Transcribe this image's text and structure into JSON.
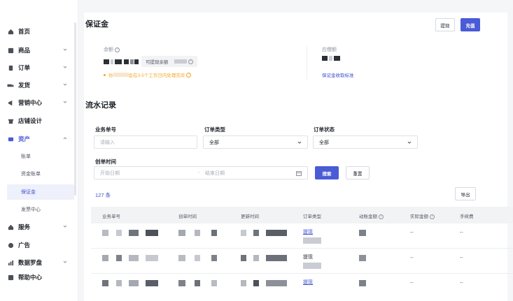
{
  "sidebar": {
    "items": [
      {
        "label": "首页",
        "icon": "home-icon"
      },
      {
        "label": "商品",
        "icon": "goods-icon"
      },
      {
        "label": "订单",
        "icon": "order-icon"
      },
      {
        "label": "发货",
        "icon": "truck-icon"
      },
      {
        "label": "营销中心",
        "icon": "megaphone-icon"
      },
      {
        "label": "店铺设计",
        "icon": "shop-icon"
      },
      {
        "label": "资产",
        "icon": "wallet-icon"
      },
      {
        "label": "服务",
        "icon": "service-icon"
      },
      {
        "label": "广告",
        "icon": "ad-icon"
      },
      {
        "label": "数据罗盘",
        "icon": "chart-icon"
      },
      {
        "label": "帮助中心",
        "icon": "help-icon"
      }
    ],
    "asset_sub": [
      "账单",
      "资金账单",
      "保证金",
      "发票中心"
    ]
  },
  "deposit": {
    "title": "保证金",
    "withdraw_label": "提现",
    "recharge_label": "充值",
    "balance_label": "余额",
    "withdrawable_label": "可提现余额",
    "notice_prefix": "你",
    "notice_suffix": "会在3-5个工作日内处理完毕",
    "payable_label": "应缴额",
    "standard_link": "保证金收取标准"
  },
  "flow": {
    "title": "流水记录",
    "filters": {
      "biz_no_label": "业务单号",
      "biz_no_placeholder": "请输入",
      "order_type_label": "订单类型",
      "order_type_value": "全部",
      "order_status_label": "订单状态",
      "order_status_value": "全部",
      "created_label": "创单时间",
      "start_placeholder": "开始日期",
      "end_placeholder": "结束日期",
      "date_separator": "-",
      "search_label": "搜索",
      "reset_label": "重置"
    },
    "count_text": "127 条",
    "export_label": "导出",
    "columns": [
      "业务单号",
      "创单时间",
      "更新时间",
      "订单类型",
      "动账金额",
      "实际金额",
      "手续费"
    ],
    "rows": [
      {
        "order_type": "提现",
        "actual": "--",
        "fee": "--"
      },
      {
        "order_type": "提现",
        "actual": "--",
        "fee": "--"
      },
      {
        "order_type": "提现",
        "actual": "--",
        "fee": "--"
      }
    ]
  },
  "colors": {
    "accent": "#4a5bd6",
    "warning": "#f5a623",
    "link": "#3d4fd1"
  }
}
